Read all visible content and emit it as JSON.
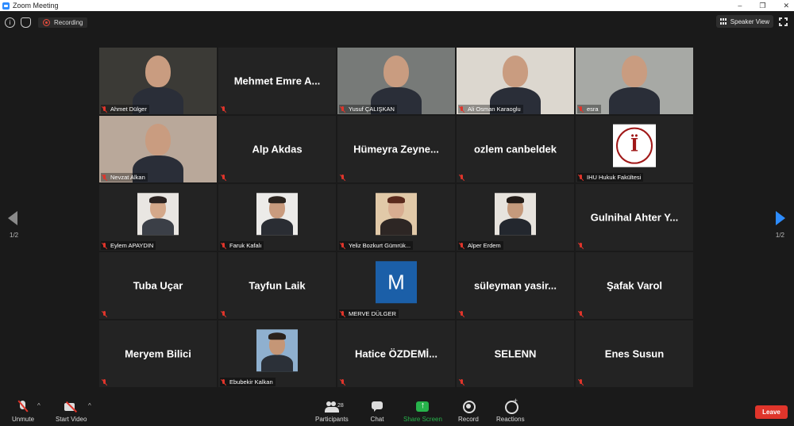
{
  "window": {
    "title": "Zoom Meeting",
    "controls": [
      "–",
      "❐",
      "✕"
    ]
  },
  "topbar": {
    "recording_label": "Recording",
    "speaker_view_label": "Speaker View"
  },
  "pagination": {
    "left": "1/2",
    "right": "1/2"
  },
  "tiles": [
    {
      "name": "Ahmet Dülger",
      "kind": "video",
      "bg": "#3b3a36"
    },
    {
      "name": "Mehmet Emre A...",
      "kind": "text"
    },
    {
      "name": "Yusuf ÇALIŞKAN",
      "kind": "video",
      "bg": "#777a78",
      "active": true
    },
    {
      "name": "Ali Osman Karaoglu",
      "kind": "video",
      "bg": "#dcd7cf"
    },
    {
      "name": "esra",
      "kind": "video",
      "bg": "#a7a9a5"
    },
    {
      "name": "Nevzat Alkan",
      "kind": "video",
      "bg": "#b9a89a"
    },
    {
      "name": "Alp Akdas",
      "kind": "text"
    },
    {
      "name": "Hümeyra Zeyne...",
      "kind": "text"
    },
    {
      "name": "ozlem canbeldek",
      "kind": "text"
    },
    {
      "name": "IHU Hukuk Fakültesi",
      "kind": "logo"
    },
    {
      "name": "Eylem APAYDIN",
      "kind": "photo",
      "bg": "#e9e6e2",
      "skin": "#d4a88a",
      "hair": "#2a2220",
      "suit": "#3b3f47"
    },
    {
      "name": "Faruk Kafalı",
      "kind": "photo",
      "bg": "#ecebe9",
      "skin": "#c99b7e",
      "hair": "#2b241f",
      "suit": "#2a2d33"
    },
    {
      "name": "Yeliz Bozkurt Gümrük...",
      "kind": "photo",
      "bg": "#e1c9a8",
      "skin": "#d8ad91",
      "hair": "#5a2a1d",
      "suit": "#2d2624"
    },
    {
      "name": "Alper Erdem",
      "kind": "photo",
      "bg": "#e7e3dd",
      "skin": "#c59a7c",
      "hair": "#221b17",
      "suit": "#23272e"
    },
    {
      "name": "Gulnihal Ahter Y...",
      "kind": "text"
    },
    {
      "name": "Tuba Uçar",
      "kind": "text",
      "nolabel": true
    },
    {
      "name": "Tayfun Laik",
      "kind": "text",
      "nolabel": true
    },
    {
      "name": "MERVE DÜLGER",
      "kind": "avatar",
      "letter": "M"
    },
    {
      "name": "süleyman yasir...",
      "kind": "text"
    },
    {
      "name": "Şafak Varol",
      "kind": "text",
      "nolabel": true
    },
    {
      "name": "Meryem Bilici",
      "kind": "text"
    },
    {
      "name": "Ebubekir Kalkan",
      "kind": "photo",
      "bg": "#8fb0cf",
      "skin": "#c59676",
      "hair": "#2a221c",
      "suit": "#2b3038"
    },
    {
      "name": "Hatice ÖZDEMİ...",
      "kind": "text"
    },
    {
      "name": "SELENN",
      "kind": "text"
    },
    {
      "name": "Enes Susun",
      "kind": "text"
    }
  ],
  "toolbar": {
    "unmute": "Unmute",
    "start_video": "Start Video",
    "participants": "Participants",
    "participants_count": "28",
    "chat": "Chat",
    "share_screen": "Share Screen",
    "record": "Record",
    "reactions": "Reactions",
    "leave": "Leave"
  },
  "colors": {
    "active_speaker": "#c8e04a",
    "share_green": "#27b34b",
    "leave_red": "#e0352b",
    "nav_blue": "#2d8cff"
  }
}
